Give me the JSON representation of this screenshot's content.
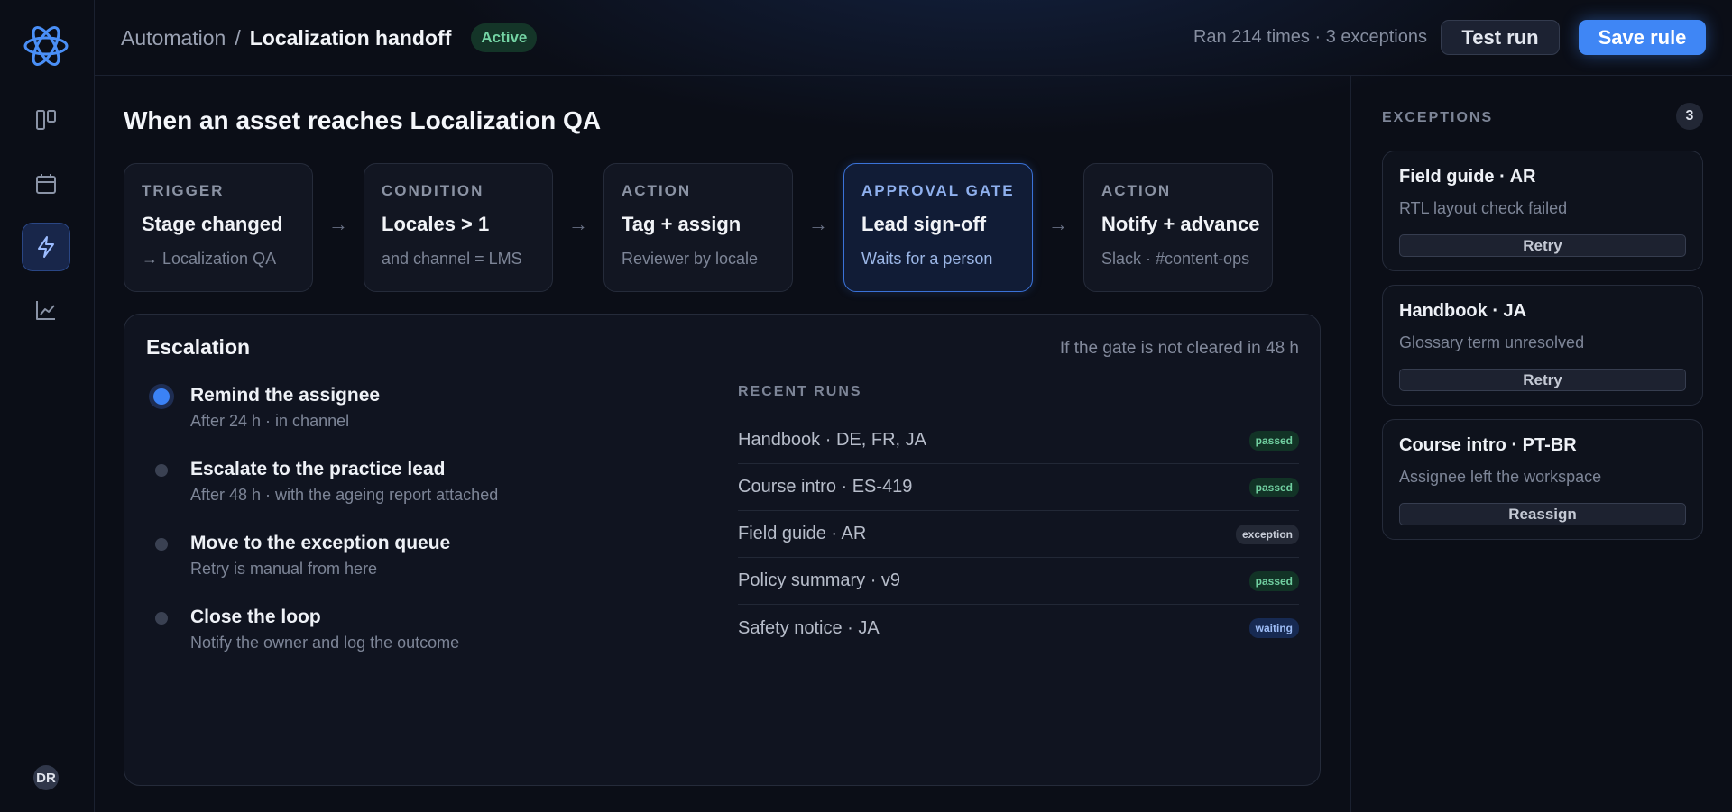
{
  "sidebar": {
    "logo_icon": "atom-logo-icon",
    "nav": [
      {
        "icon": "board-icon"
      },
      {
        "icon": "calendar-icon"
      },
      {
        "icon": "lightning-icon",
        "active": true
      },
      {
        "icon": "chart-line-icon"
      }
    ],
    "avatar_initials": "DR"
  },
  "header": {
    "breadcrumb_parent": "Automation",
    "breadcrumb_sep": "/",
    "breadcrumb_current": "Localization handoff",
    "status_badge": "Active",
    "run_stats": "Ran 214 times · 3 exceptions",
    "test_run_label": "Test run",
    "save_rule_label": "Save rule"
  },
  "main": {
    "title": "When an asset reaches Localization QA",
    "steps": [
      {
        "kind": "TRIGGER",
        "title": "Stage changed",
        "sub": "→ Localization QA"
      },
      {
        "kind": "CONDITION",
        "title": "Locales > 1",
        "sub": "and channel = LMS"
      },
      {
        "kind": "ACTION",
        "title": "Tag + assign",
        "sub": "Reviewer by locale"
      },
      {
        "kind": "APPROVAL GATE",
        "title": "Lead sign-off",
        "sub": "Waits for a person"
      },
      {
        "kind": "ACTION",
        "title": "Notify + advance",
        "sub": "Slack · #content-ops"
      }
    ],
    "arrow": "→"
  },
  "escalation": {
    "title": "Escalation",
    "note": "If the gate is not cleared in 48 h",
    "timeline": [
      {
        "title": "Remind the assignee",
        "sub": "After 24 h · in channel"
      },
      {
        "title": "Escalate to the practice lead",
        "sub": "After 48 h · with the ageing report attached"
      },
      {
        "title": "Move to the exception queue",
        "sub": "Retry is manual from here"
      },
      {
        "title": "Close the loop",
        "sub": "Notify the owner and log the outcome"
      }
    ],
    "recent_runs_label": "RECENT RUNS",
    "recent_runs": [
      {
        "name": "Handbook · DE, FR, JA",
        "status": "passed"
      },
      {
        "name": "Course intro · ES-419",
        "status": "passed"
      },
      {
        "name": "Field guide · AR",
        "status": "exception"
      },
      {
        "name": "Policy summary · v9",
        "status": "passed"
      },
      {
        "name": "Safety notice · JA",
        "status": "waiting"
      }
    ]
  },
  "exceptions": {
    "label": "EXCEPTIONS",
    "count": "3",
    "items": [
      {
        "title": "Field guide · AR",
        "sub": "RTL layout check failed",
        "action": "Retry"
      },
      {
        "title": "Handbook · JA",
        "sub": "Glossary term unresolved",
        "action": "Retry"
      },
      {
        "title": "Course intro · PT-BR",
        "sub": "Assignee left the workspace",
        "action": "Reassign"
      }
    ]
  },
  "colors": {
    "accent": "#3f86f5",
    "passed": "#70cfa0",
    "waiting": "#9dbcf5",
    "background": "#0b0e17"
  }
}
